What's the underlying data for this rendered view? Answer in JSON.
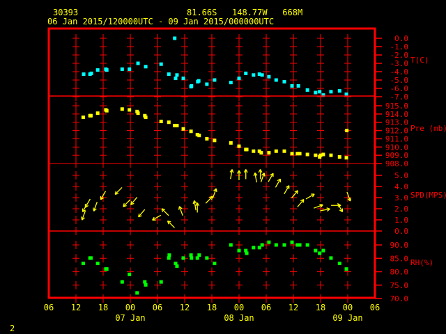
{
  "header": {
    "station_id": "30393",
    "location": "81.66S   148.77W   668M",
    "time_range": "06 Jan 2015/120000UTC - 09 Jan 2015/000000UTC"
  },
  "footer": {
    "page_number": "2"
  },
  "colors": {
    "frame": "#ff0000",
    "temperature": "#00ffff",
    "pressure": "#ffff00",
    "wind": "#ffff00",
    "humidity": "#00ff00",
    "text": "#ffff00"
  },
  "x_axis": {
    "unit": "hours since 06 Jan 2015 06UTC",
    "range": [
      0,
      72
    ],
    "ticks": [
      {
        "h": 0,
        "label": "06"
      },
      {
        "h": 6,
        "label": "12"
      },
      {
        "h": 12,
        "label": "18"
      },
      {
        "h": 18,
        "label": "00"
      },
      {
        "h": 24,
        "label": "06"
      },
      {
        "h": 30,
        "label": "12"
      },
      {
        "h": 36,
        "label": "18"
      },
      {
        "h": 42,
        "label": "00"
      },
      {
        "h": 48,
        "label": "06"
      },
      {
        "h": 54,
        "label": "12"
      },
      {
        "h": 60,
        "label": "18"
      },
      {
        "h": 66,
        "label": "00"
      },
      {
        "h": 72,
        "label": "06"
      }
    ],
    "dates": [
      {
        "h": 18,
        "label": "07 Jan"
      },
      {
        "h": 42,
        "label": "08 Jan"
      },
      {
        "h": 66,
        "label": "09 Jan"
      }
    ]
  },
  "chart_data": [
    {
      "type": "scatter",
      "id": "temperature",
      "ylabel": "T(C)",
      "ylim": [
        -7,
        0
      ],
      "ticks": [
        {
          "v": 0,
          "label": "0.0"
        },
        {
          "v": -1,
          "label": "-1.0"
        },
        {
          "v": -2,
          "label": "-2.0"
        },
        {
          "v": -3,
          "label": "-3.0"
        },
        {
          "v": -4,
          "label": "-4.0"
        },
        {
          "v": -5,
          "label": "-5.0"
        },
        {
          "v": -6,
          "label": "-6.0"
        },
        {
          "v": -7,
          "label": "-7.0"
        }
      ],
      "x": [
        7.7,
        9.1,
        9.4,
        10.8,
        12.6,
        12.8,
        16.2,
        17.8,
        19.7,
        21.4,
        24.8,
        26.5,
        27.8,
        28.0,
        28.3,
        29.7,
        31.4,
        31.5,
        32.9,
        33.1,
        34.9,
        36.6,
        40.2,
        42.0,
        43.5,
        45.2,
        46.5,
        47.1,
        48.6,
        50.2,
        52.0,
        53.7,
        55.1,
        57.1,
        58.9,
        59.8,
        60.6,
        62.3,
        64.2,
        65.7
      ],
      "y": [
        -4.3,
        -4.3,
        -4.2,
        -3.8,
        -3.7,
        -3.8,
        -3.7,
        -3.7,
        -3.0,
        -3.4,
        -3.1,
        -4.3,
        0.0,
        -4.8,
        -4.4,
        -4.8,
        -5.8,
        -5.7,
        -5.2,
        -5.1,
        -5.5,
        -5.0,
        -5.3,
        -4.8,
        -4.2,
        -4.4,
        -4.3,
        -4.4,
        -4.6,
        -5.0,
        -5.2,
        -5.7,
        -5.7,
        -6.2,
        -6.5,
        -6.4,
        -6.8,
        -6.4,
        -6.3,
        -6.7
      ]
    },
    {
      "type": "scatter",
      "id": "pressure",
      "ylabel": "Pre (mb)",
      "ylim": [
        908,
        915
      ],
      "ticks": [
        {
          "v": 915,
          "label": "915.0"
        },
        {
          "v": 914,
          "label": "914.0"
        },
        {
          "v": 913,
          "label": "913.0"
        },
        {
          "v": 912,
          "label": "912.0"
        },
        {
          "v": 911,
          "label": "911.0"
        },
        {
          "v": 910,
          "label": "910.0"
        },
        {
          "v": 909,
          "label": "909.0"
        },
        {
          "v": 908,
          "label": "908.0"
        }
      ],
      "x": [
        7.6,
        9.1,
        9.3,
        10.8,
        12.6,
        12.8,
        16.2,
        17.8,
        19.5,
        19.7,
        21.2,
        21.4,
        24.8,
        26.5,
        27.8,
        28.3,
        29.7,
        31.4,
        32.8,
        33.2,
        34.9,
        36.6,
        40.2,
        42.0,
        43.5,
        43.7,
        45.2,
        46.5,
        46.9,
        48.6,
        50.2,
        52.0,
        53.7,
        54.9,
        55.4,
        57.1,
        58.9,
        59.8,
        60.0,
        60.6,
        62.3,
        64.2,
        65.7,
        65.8
      ],
      "y": [
        913.6,
        913.8,
        913.8,
        914.1,
        914.5,
        914.4,
        914.6,
        914.5,
        914.3,
        914.1,
        913.8,
        913.6,
        913.1,
        913.0,
        912.6,
        912.6,
        912.2,
        911.9,
        911.5,
        911.4,
        911.0,
        910.8,
        910.5,
        910.1,
        909.7,
        909.7,
        909.5,
        909.5,
        909.3,
        909.3,
        909.5,
        909.5,
        909.2,
        909.2,
        909.2,
        909.1,
        909.0,
        908.8,
        909.0,
        909.1,
        909.0,
        908.8,
        908.7,
        912.0
      ]
    },
    {
      "type": "vector",
      "id": "wind",
      "ylabel": "SPD(MPS)",
      "ylim": [
        0,
        5
      ],
      "direction_unit": "degrees (from)",
      "ticks": [
        {
          "v": 5,
          "label": "5.0"
        },
        {
          "v": 4,
          "label": "4.0"
        },
        {
          "v": 3,
          "label": "3.0"
        },
        {
          "v": 2,
          "label": "2.0"
        },
        {
          "v": 1,
          "label": "1.0"
        },
        {
          "v": 0,
          "label": "0.0"
        }
      ],
      "x": [
        7.7,
        8.0,
        8.6,
        10.3,
        12.0,
        15.4,
        17.2,
        18.8,
        20.5,
        23.8,
        25.7,
        27.0,
        29.2,
        32.3,
        32.8,
        35.4,
        36.6,
        40.3,
        42.0,
        43.5,
        45.7,
        46.7,
        47.2,
        49.0,
        50.6,
        52.5,
        54.3,
        55.6,
        57.7,
        59.5,
        61.0,
        63.4,
        64.3,
        66.2
      ],
      "speed": [
        1.4,
        2.1,
        2.5,
        2.2,
        3.2,
        3.6,
        2.5,
        2.7,
        1.6,
        1.2,
        1.7,
        0.6,
        1.8,
        2.3,
        2.1,
        2.8,
        3.4,
        5.1,
        5.0,
        5.1,
        4.8,
        5.1,
        4.8,
        4.8,
        4.3,
        3.7,
        3.3,
        2.5,
        3.1,
        2.2,
        1.9,
        2.3,
        2.1,
        3.1
      ],
      "direction": [
        20,
        30,
        30,
        20,
        30,
        45,
        45,
        40,
        40,
        60,
        135,
        135,
        160,
        170,
        180,
        225,
        200,
        190,
        180,
        180,
        170,
        180,
        200,
        210,
        210,
        210,
        220,
        220,
        240,
        250,
        260,
        270,
        330,
        340
      ]
    },
    {
      "type": "scatter",
      "id": "humidity",
      "ylabel": "RH(%)",
      "ylim": [
        70,
        90
      ],
      "ticks": [
        {
          "v": 90,
          "label": "90.0"
        },
        {
          "v": 85,
          "label": "85.0"
        },
        {
          "v": 80,
          "label": "80.0"
        },
        {
          "v": 75,
          "label": "75.0"
        },
        {
          "v": 70,
          "label": "70.0"
        }
      ],
      "x": [
        7.6,
        9.1,
        9.3,
        10.8,
        12.6,
        12.8,
        16.2,
        17.8,
        19.5,
        21.2,
        21.4,
        24.8,
        26.5,
        26.6,
        28.0,
        28.3,
        29.7,
        31.4,
        31.5,
        32.8,
        33.2,
        34.9,
        36.6,
        40.2,
        42.0,
        43.5,
        43.7,
        45.2,
        46.5,
        47.1,
        48.6,
        50.2,
        52.0,
        53.7,
        54.9,
        55.4,
        57.1,
        58.9,
        59.8,
        60.6,
        62.3,
        64.2,
        65.7
      ],
      "y": [
        83.1,
        85.1,
        85.1,
        83.1,
        81.0,
        81.0,
        76.2,
        79.0,
        72.1,
        76.2,
        75.1,
        76.2,
        85.1,
        86.2,
        83.1,
        82.1,
        85.1,
        86.2,
        85.1,
        85.1,
        86.2,
        85.1,
        83.1,
        90.0,
        87.9,
        87.9,
        86.9,
        89.0,
        89.0,
        90.0,
        91.0,
        90.0,
        90.0,
        91.0,
        90.0,
        90.0,
        90.0,
        87.9,
        86.9,
        87.9,
        85.1,
        83.1,
        81.0
      ]
    }
  ]
}
